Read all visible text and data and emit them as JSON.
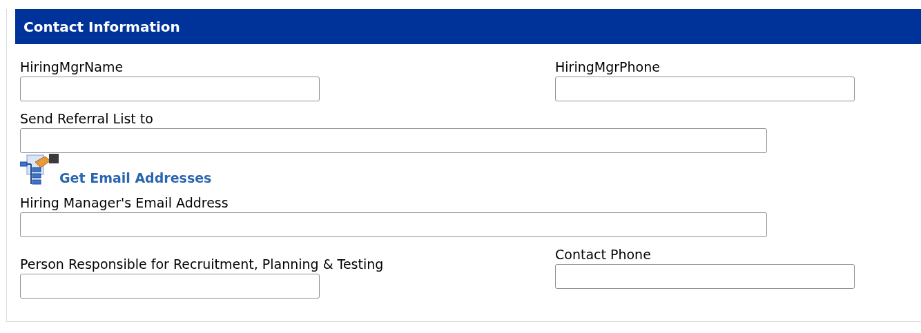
{
  "section": {
    "title": "Contact Information"
  },
  "rows": [
    {
      "kind": "pair",
      "fields": [
        {
          "label": "HiringMgrName"
        },
        {
          "label": "HiringMgrPhone"
        }
      ]
    },
    {
      "kind": "wide",
      "fields": [
        {
          "label": "Send Referral List to"
        }
      ]
    },
    {
      "kind": "link",
      "text": "Get Email Addresses"
    },
    {
      "kind": "wide",
      "fields": [
        {
          "label": "Hiring Manager's Email Address"
        }
      ]
    },
    {
      "kind": "pair-offset",
      "fields": [
        {
          "label": "Person Responsible for Recruitment, Planning & Testing"
        },
        {
          "label": "Contact Phone"
        }
      ]
    }
  ]
}
